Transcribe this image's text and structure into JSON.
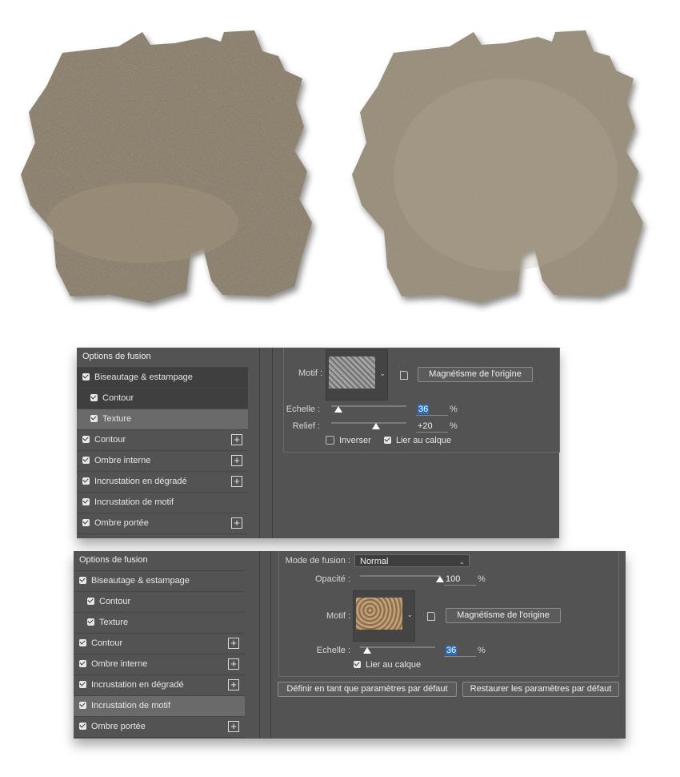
{
  "colors": {
    "panel_bg": "#535353",
    "selected_row": "#6a6a6a",
    "dark_row": "#3f3f3f",
    "highlight": "#2a6fbf"
  },
  "top_panel": {
    "sidebar_title": "Options de fusion",
    "items": [
      {
        "label": "Biseautage & estampage",
        "checked": true,
        "add": false
      },
      {
        "label": "Contour",
        "checked": true,
        "add": false
      },
      {
        "label": "Texture",
        "checked": true,
        "add": false,
        "selected": true
      },
      {
        "label": "Contour",
        "checked": true,
        "add": true
      },
      {
        "label": "Ombre interne",
        "checked": true,
        "add": true
      },
      {
        "label": "Incrustation en dégradé",
        "checked": true,
        "add": true
      },
      {
        "label": "Incrustation de motif",
        "checked": true,
        "add": false
      },
      {
        "label": "Ombre portée",
        "checked": true,
        "add": true
      }
    ],
    "motif_label": "Motif :",
    "snap_button": "Magnétisme de l'origine",
    "scale_label": "Echelle :",
    "scale_value": "36",
    "scale_unit": "%",
    "scale_level": 0.1,
    "relief_label": "Relief :",
    "relief_value": "+20",
    "relief_unit": "%",
    "relief_level": 0.6,
    "invert_label": "Inverser",
    "invert_checked": false,
    "link_label": "Lier au calque",
    "link_checked": true
  },
  "bottom_panel": {
    "sidebar_title": "Options de fusion",
    "items": [
      {
        "label": "Biseautage & estampage",
        "checked": true,
        "add": false
      },
      {
        "label": "Contour",
        "checked": true,
        "add": false
      },
      {
        "label": "Texture",
        "checked": true,
        "add": false
      },
      {
        "label": "Contour",
        "checked": true,
        "add": true
      },
      {
        "label": "Ombre interne",
        "checked": true,
        "add": true
      },
      {
        "label": "Incrustation en dégradé",
        "checked": true,
        "add": true
      },
      {
        "label": "Incrustation de motif",
        "checked": true,
        "add": false,
        "selected": true
      },
      {
        "label": "Ombre portée",
        "checked": true,
        "add": true
      }
    ],
    "blend_mode_label": "Mode de fusion :",
    "blend_mode_value": "Normal",
    "opacity_label": "Opacité :",
    "opacity_value": "100",
    "opacity_unit": "%",
    "opacity_level": 1.0,
    "motif_label": "Motif :",
    "snap_button": "Magnétisme de l'origine",
    "scale_label": "Echelle :",
    "scale_value": "36",
    "scale_unit": "%",
    "scale_level": 0.1,
    "link_label": "Lier au calque",
    "link_checked": true,
    "default_button": "Définir en tant que paramètres par défaut",
    "restore_button": "Restaurer les paramètres par défaut"
  }
}
